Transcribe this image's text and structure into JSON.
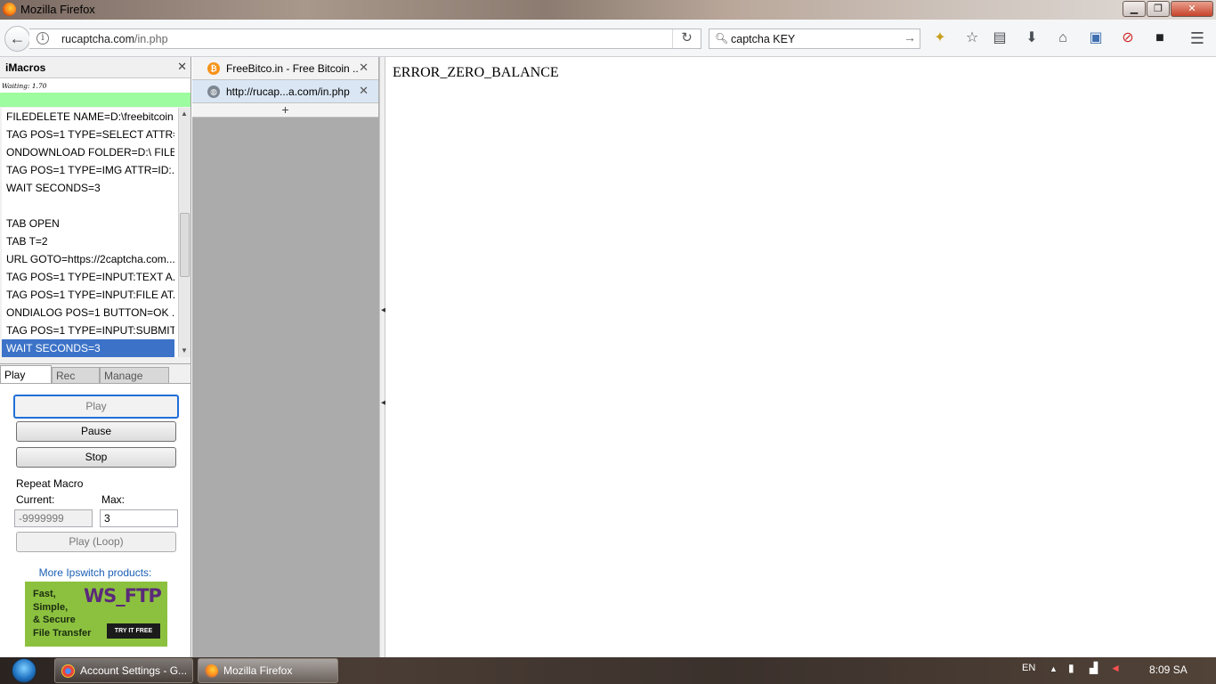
{
  "window": {
    "title": "Mozilla Firefox",
    "controls": {
      "minimize": "▁",
      "maximize": "❐",
      "close": "✕"
    }
  },
  "toolbar": {
    "url_host": "rucaptcha.com",
    "url_path": "/in.php",
    "search_value": "captcha KEY",
    "icons": [
      "back-icon",
      "info-icon",
      "reload-icon",
      "search-icon",
      "go-icon",
      "extension-icon",
      "bookmark-star-icon",
      "reading-list-icon",
      "download-icon",
      "home-icon",
      "screenshot-icon",
      "blocked-icon",
      "tab-groups-icon",
      "menu-icon"
    ]
  },
  "imacros": {
    "title": "iMacros",
    "waiting": "Waiting: 1.70",
    "lines": [
      "FILEDELETE NAME=D:\\freebitcoin...",
      "TAG POS=1 TYPE=SELECT ATTR=...",
      "ONDOWNLOAD FOLDER=D:\\ FILE...",
      "TAG POS=1 TYPE=IMG ATTR=ID:...",
      "WAIT SECONDS=3",
      "",
      "TAB OPEN",
      "TAB T=2",
      "URL GOTO=https://2captcha.com...",
      "TAG POS=1 TYPE=INPUT:TEXT A...",
      "TAG POS=1 TYPE=INPUT:FILE AT...",
      "ONDIALOG POS=1 BUTTON=OK ...",
      "TAG POS=1 TYPE=INPUT:SUBMIT...",
      "WAIT SECONDS=3"
    ],
    "tabs": {
      "play": "Play",
      "rec": "Rec",
      "manage": "Manage"
    },
    "buttons": {
      "play": "Play",
      "pause": "Pause",
      "stop": "Stop",
      "play_loop": "Play (Loop)"
    },
    "repeat_label": "Repeat Macro",
    "current_label": "Current:",
    "max_label": "Max:",
    "current_value": "-9999999",
    "max_value": "3",
    "more_products": "More Ipswitch products:",
    "ad": {
      "tagline1": "Fast,",
      "tagline2": "Simple,",
      "tagline3": "& Secure",
      "tagline4": "File Transfer",
      "brand": "WS_FTP",
      "cta": "TRY IT FREE"
    }
  },
  "tabs": [
    {
      "label": "FreeBitco.in - Free Bitcoin ...",
      "active": false
    },
    {
      "label": "http://rucap...a.com/in.php",
      "active": true
    }
  ],
  "new_tab": "+",
  "content": {
    "message": "ERROR_ZERO_BALANCE"
  },
  "taskbar": {
    "tasks": [
      "Account Settings - G...",
      "Mozilla Firefox"
    ],
    "lang": "EN",
    "time": "8:09 SA"
  }
}
